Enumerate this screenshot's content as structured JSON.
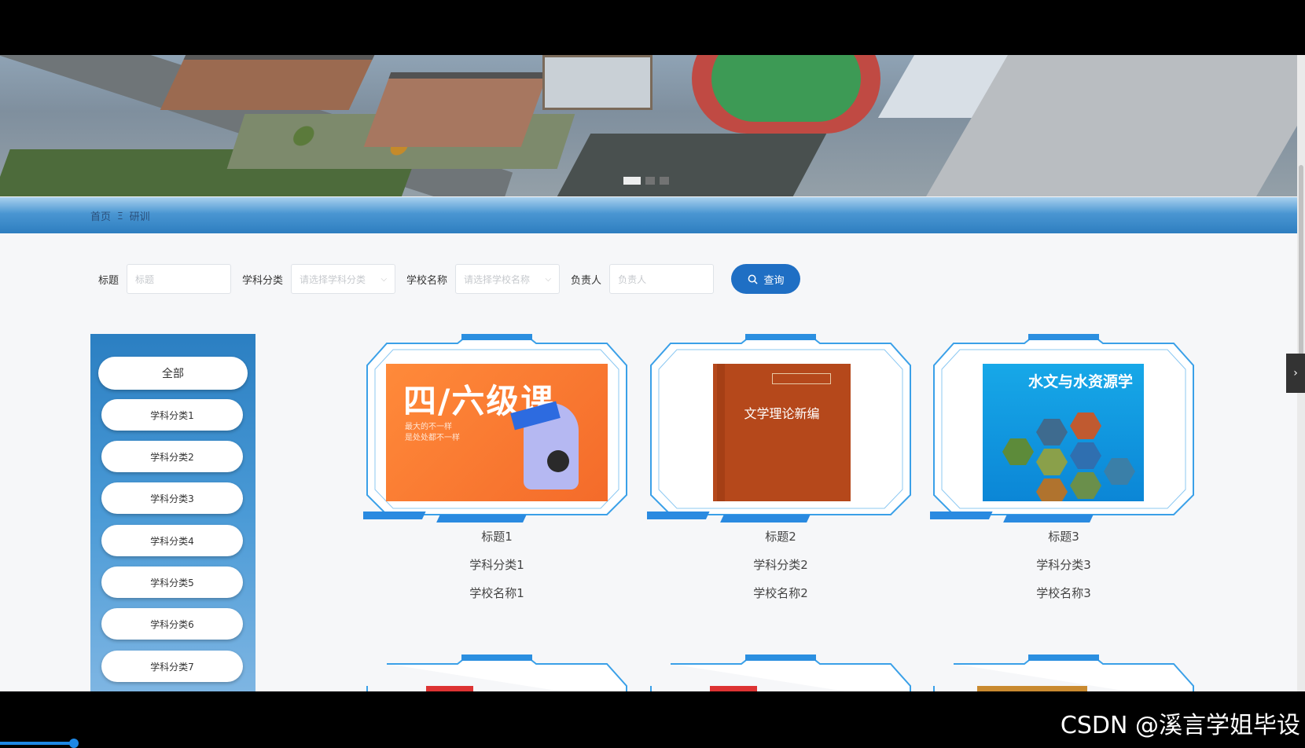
{
  "breadcrumb": {
    "home": "首页",
    "separator": "Ξ",
    "current": "研训"
  },
  "search": {
    "title_label": "标题",
    "title_placeholder": "标题",
    "subject_label": "学科分类",
    "subject_placeholder": "请选择学科分类",
    "school_label": "学校名称",
    "school_placeholder": "请选择学校名称",
    "owner_label": "负责人",
    "owner_placeholder": "负责人",
    "button_label": "查询"
  },
  "sidebar": {
    "items": [
      {
        "label": "全部"
      },
      {
        "label": "学科分类1"
      },
      {
        "label": "学科分类2"
      },
      {
        "label": "学科分类3"
      },
      {
        "label": "学科分类4"
      },
      {
        "label": "学科分类5"
      },
      {
        "label": "学科分类6"
      },
      {
        "label": "学科分类7"
      }
    ]
  },
  "cards": [
    {
      "title": "标题1",
      "subject": "学科分类1",
      "school": "学校名称1",
      "cover": {
        "big": "四/六级课",
        "line1": "最大的不一样",
        "line2": "是处处都不一样"
      }
    },
    {
      "title": "标题2",
      "subject": "学科分类2",
      "school": "学校名称2",
      "cover": {
        "title": "文学理论新编"
      }
    },
    {
      "title": "标题3",
      "subject": "学科分类3",
      "school": "学校名称3",
      "cover": {
        "title": "水文与水资源学"
      }
    }
  ],
  "watermark": "CSDN @溪言学姐毕设",
  "colors": {
    "accent": "#1f6fc4",
    "sidebar": "#2b7fc2",
    "frame": "#3aa0e8"
  }
}
